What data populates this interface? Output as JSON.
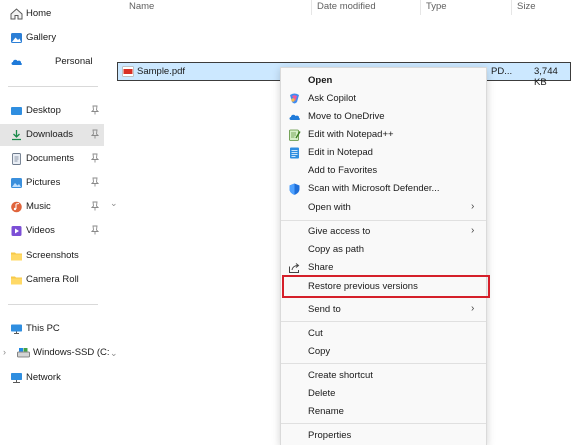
{
  "sidebar": {
    "home": "Home",
    "gallery": "Gallery",
    "onedrive": "Personal",
    "quick_access": [
      {
        "label": "Desktop"
      },
      {
        "label": "Downloads"
      },
      {
        "label": "Documents"
      },
      {
        "label": "Pictures"
      },
      {
        "label": "Music"
      },
      {
        "label": "Videos"
      },
      {
        "label": "Screenshots"
      },
      {
        "label": "Camera Roll"
      }
    ],
    "this_pc": "This PC",
    "drive": "Windows-SSD (C:",
    "network": "Network"
  },
  "columns": {
    "name": "Name",
    "date_modified": "Date modified",
    "type": "Type",
    "size": "Size"
  },
  "file": {
    "name": "Sample.pdf",
    "type": "PD...",
    "size": "3,744 KB"
  },
  "context_menu": {
    "open": "Open",
    "ask_copilot": "Ask Copilot",
    "move_onedrive": "Move to OneDrive",
    "edit_npp": "Edit with Notepad++",
    "edit_notepad": "Edit in Notepad",
    "add_favorites": "Add to Favorites",
    "scan_defender": "Scan with Microsoft Defender...",
    "open_with": "Open with",
    "give_access": "Give access to",
    "copy_path": "Copy as path",
    "share": "Share",
    "restore_versions": "Restore previous versions",
    "send_to": "Send to",
    "cut": "Cut",
    "copy": "Copy",
    "create_shortcut": "Create shortcut",
    "delete": "Delete",
    "rename": "Rename",
    "properties": "Properties"
  },
  "colors": {
    "accent": "#0067c0",
    "selection": "#cce8ff",
    "highlight_box": "#d51f2a"
  }
}
